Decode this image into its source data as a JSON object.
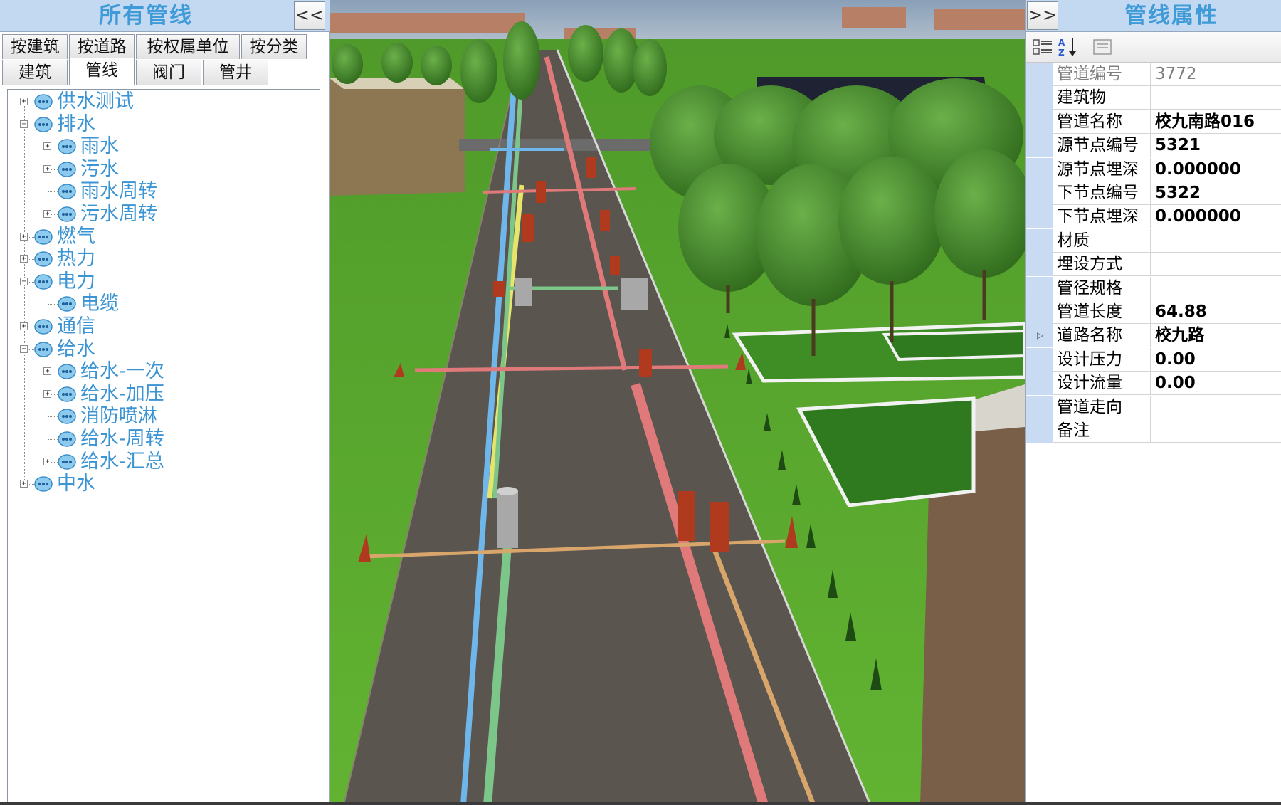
{
  "left_panel": {
    "title": "所有管线",
    "collapse_label": "<<",
    "tabs_row1": [
      "按建筑",
      "按道路",
      "按权属单位",
      "按分类"
    ],
    "tabs_row2": [
      "建筑",
      "管线",
      "阀门",
      "管井"
    ],
    "active_tab": "管线",
    "tree": [
      {
        "label": "供水测试",
        "level": 0,
        "expander": "+"
      },
      {
        "label": "排水",
        "level": 0,
        "expander": "-"
      },
      {
        "label": "雨水",
        "level": 1,
        "expander": "+"
      },
      {
        "label": "污水",
        "level": 1,
        "expander": "+"
      },
      {
        "label": "雨水周转",
        "level": 1,
        "expander": ""
      },
      {
        "label": "污水周转",
        "level": 1,
        "expander": "+"
      },
      {
        "label": "燃气",
        "level": 0,
        "expander": "+"
      },
      {
        "label": "热力",
        "level": 0,
        "expander": "+"
      },
      {
        "label": "电力",
        "level": 0,
        "expander": "-"
      },
      {
        "label": "电缆",
        "level": 1,
        "expander": ""
      },
      {
        "label": "通信",
        "level": 0,
        "expander": "+"
      },
      {
        "label": "给水",
        "level": 0,
        "expander": "-"
      },
      {
        "label": "给水-一次",
        "level": 1,
        "expander": "+"
      },
      {
        "label": "给水-加压",
        "level": 1,
        "expander": "+"
      },
      {
        "label": "消防喷淋",
        "level": 1,
        "expander": ""
      },
      {
        "label": "给水-周转",
        "level": 1,
        "expander": ""
      },
      {
        "label": "给水-汇总",
        "level": 1,
        "expander": "+"
      },
      {
        "label": "中水",
        "level": 0,
        "expander": "+"
      }
    ]
  },
  "right_panel": {
    "title": "管线属性",
    "collapse_label": ">>",
    "toolbar_icons": [
      "categorized-icon",
      "sort-alpha-icon",
      "property-pages-icon"
    ],
    "properties": [
      {
        "name": "管道编号",
        "value": "3772",
        "readonly": true
      },
      {
        "name": "建筑物",
        "value": ""
      },
      {
        "name": "管道名称",
        "value": "校九南路016"
      },
      {
        "name": "源节点编号",
        "value": "5321"
      },
      {
        "name": "源节点埋深",
        "value": "0.000000"
      },
      {
        "name": "下节点编号",
        "value": "5322"
      },
      {
        "name": "下节点埋深",
        "value": "0.000000"
      },
      {
        "name": "材质",
        "value": ""
      },
      {
        "name": "埋设方式",
        "value": ""
      },
      {
        "name": "管径规格",
        "value": ""
      },
      {
        "name": "管道长度",
        "value": "64.88"
      },
      {
        "name": "道路名称",
        "value": "校九路",
        "selected": true
      },
      {
        "name": "设计压力",
        "value": "0.00"
      },
      {
        "name": "设计流量",
        "value": "0.00"
      },
      {
        "name": "管道走向",
        "value": ""
      },
      {
        "name": "备注",
        "value": ""
      }
    ]
  },
  "colors": {
    "header_bg": "#c3d9f1",
    "title_blue": "#3f9ad8",
    "tree_text": "#3b94d4",
    "grass": "#5aa72c",
    "road": "#5b5550",
    "pipe_blue": "#6fb6ea",
    "pipe_yellow": "#e6e46a",
    "pipe_green": "#7dc68a",
    "pipe_red": "#e07a7a",
    "pipe_orange": "#d8a56a"
  }
}
